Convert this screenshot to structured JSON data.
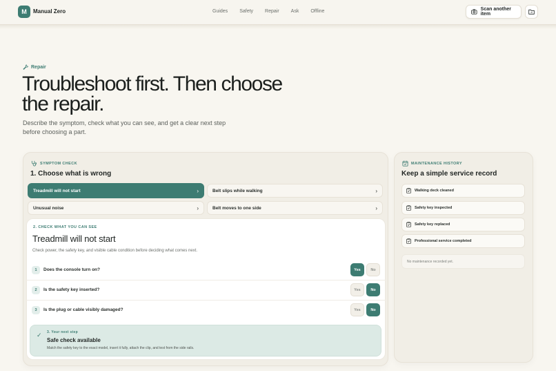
{
  "brand": {
    "logo_letter": "M",
    "name": "Manual Zero"
  },
  "nav": [
    "Guides",
    "Safety",
    "Repair",
    "Ask",
    "Offline"
  ],
  "header_actions": {
    "scan_label": "Scan another item"
  },
  "hero": {
    "eyebrow": "Repair",
    "title": "Troubleshoot first. Then choose the repair.",
    "subtitle": "Describe the symptom, check what you can see, and get a clear next step before choosing a part."
  },
  "symptom_check": {
    "label": "Symptom check",
    "title": "1. Choose what is wrong",
    "options": [
      {
        "label": "Treadmill will not start",
        "selected": true
      },
      {
        "label": "Belt slips while walking",
        "selected": false
      },
      {
        "label": "Unusual noise",
        "selected": false
      },
      {
        "label": "Belt moves to one side",
        "selected": false
      }
    ]
  },
  "check": {
    "label": "2. Check what you can see",
    "title": "Treadmill will not start",
    "description": "Check power, the safety key, and visible cable condition before deciding what comes next.",
    "yes_label": "Yes",
    "no_label": "No",
    "questions": [
      {
        "num": "1",
        "text": "Does the console turn on?",
        "answer": "yes"
      },
      {
        "num": "2",
        "text": "Is the safety key inserted?",
        "answer": "no"
      },
      {
        "num": "3",
        "text": "Is the plug or cable visibly damaged?",
        "answer": "no"
      }
    ]
  },
  "next_step": {
    "label": "3. Your next step",
    "title": "Safe check available",
    "description": "Match the safety key to the exact model, insert it fully, attach the clip, and test from the side rails."
  },
  "history": {
    "label": "Maintenance history",
    "title": "Keep a simple service record",
    "items": [
      "Walking deck cleaned",
      "Safety key inspected",
      "Safety key replaced",
      "Professional service completed"
    ],
    "empty": "No maintenance recorded yet."
  },
  "colors": {
    "accent": "#3d7c72",
    "background": "#f8f6f0",
    "next_step_bg": "#dceae5"
  }
}
